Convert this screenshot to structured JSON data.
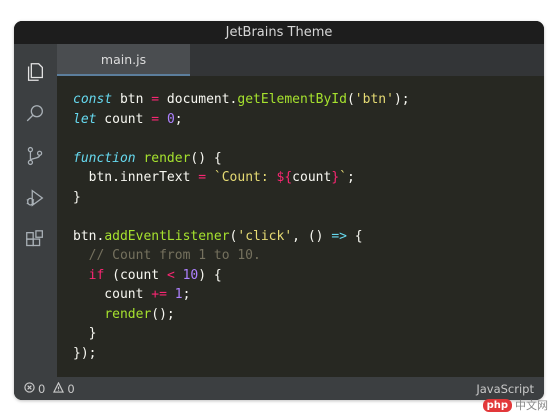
{
  "window": {
    "title": "JetBrains Theme"
  },
  "tabs": [
    {
      "label": "main.js"
    }
  ],
  "activity_icons": [
    "files-icon",
    "search-icon",
    "source-control-icon",
    "run-debug-icon",
    "extensions-icon"
  ],
  "editor": {
    "lines": [
      [
        {
          "t": "const",
          "c": "#66d9ef",
          "i": true
        },
        {
          "t": " btn ",
          "c": "#f8f8f2"
        },
        {
          "t": "=",
          "c": "#f92672"
        },
        {
          "t": " document.",
          "c": "#f8f8f2"
        },
        {
          "t": "getElementById",
          "c": "#a6e22e"
        },
        {
          "t": "(",
          "c": "#f8f8f2"
        },
        {
          "t": "'btn'",
          "c": "#e6db74"
        },
        {
          "t": ");",
          "c": "#f8f8f2"
        }
      ],
      [
        {
          "t": "let",
          "c": "#66d9ef",
          "i": true
        },
        {
          "t": " count ",
          "c": "#f8f8f2"
        },
        {
          "t": "=",
          "c": "#f92672"
        },
        {
          "t": " ",
          "c": "#f8f8f2"
        },
        {
          "t": "0",
          "c": "#ae81ff"
        },
        {
          "t": ";",
          "c": "#f8f8f2"
        }
      ],
      [],
      [
        {
          "t": "function",
          "c": "#66d9ef",
          "i": true
        },
        {
          "t": " ",
          "c": "#f8f8f2"
        },
        {
          "t": "render",
          "c": "#a6e22e"
        },
        {
          "t": "() {",
          "c": "#f8f8f2"
        }
      ],
      [
        {
          "t": "  btn.innerText ",
          "c": "#f8f8f2"
        },
        {
          "t": "=",
          "c": "#f92672"
        },
        {
          "t": " ",
          "c": "#f8f8f2"
        },
        {
          "t": "`Count: ",
          "c": "#e6db74"
        },
        {
          "t": "${",
          "c": "#f92672"
        },
        {
          "t": "count",
          "c": "#f8f8f2"
        },
        {
          "t": "}",
          "c": "#f92672"
        },
        {
          "t": "`",
          "c": "#e6db74"
        },
        {
          "t": ";",
          "c": "#f8f8f2"
        }
      ],
      [
        {
          "t": "}",
          "c": "#f8f8f2"
        }
      ],
      [],
      [
        {
          "t": "btn.",
          "c": "#f8f8f2"
        },
        {
          "t": "addEventListener",
          "c": "#a6e22e"
        },
        {
          "t": "(",
          "c": "#f8f8f2"
        },
        {
          "t": "'click'",
          "c": "#e6db74"
        },
        {
          "t": ", () ",
          "c": "#f8f8f2"
        },
        {
          "t": "=>",
          "c": "#66d9ef"
        },
        {
          "t": " {",
          "c": "#f8f8f2"
        }
      ],
      [
        {
          "t": "  // Count from 1 to 10.",
          "c": "#75715e"
        }
      ],
      [
        {
          "t": "  ",
          "c": "#f8f8f2"
        },
        {
          "t": "if",
          "c": "#f92672"
        },
        {
          "t": " (count ",
          "c": "#f8f8f2"
        },
        {
          "t": "<",
          "c": "#f92672"
        },
        {
          "t": " ",
          "c": "#f8f8f2"
        },
        {
          "t": "10",
          "c": "#ae81ff"
        },
        {
          "t": ") {",
          "c": "#f8f8f2"
        }
      ],
      [
        {
          "t": "    count ",
          "c": "#f8f8f2"
        },
        {
          "t": "+=",
          "c": "#f92672"
        },
        {
          "t": " ",
          "c": "#f8f8f2"
        },
        {
          "t": "1",
          "c": "#ae81ff"
        },
        {
          "t": ";",
          "c": "#f8f8f2"
        }
      ],
      [
        {
          "t": "    ",
          "c": "#f8f8f2"
        },
        {
          "t": "render",
          "c": "#a6e22e"
        },
        {
          "t": "();",
          "c": "#f8f8f2"
        }
      ],
      [
        {
          "t": "  }",
          "c": "#f8f8f2"
        }
      ],
      [
        {
          "t": "});",
          "c": "#f8f8f2"
        }
      ]
    ]
  },
  "status": {
    "errors": "0",
    "warnings": "0",
    "language": "JavaScript"
  },
  "watermark": {
    "logo": "php",
    "text": "中文网"
  },
  "colors": {
    "background": "#272822",
    "titlebar": "#1d1d1d",
    "sidebar": "#3c3f41",
    "tab_active": "#4a4d50"
  }
}
